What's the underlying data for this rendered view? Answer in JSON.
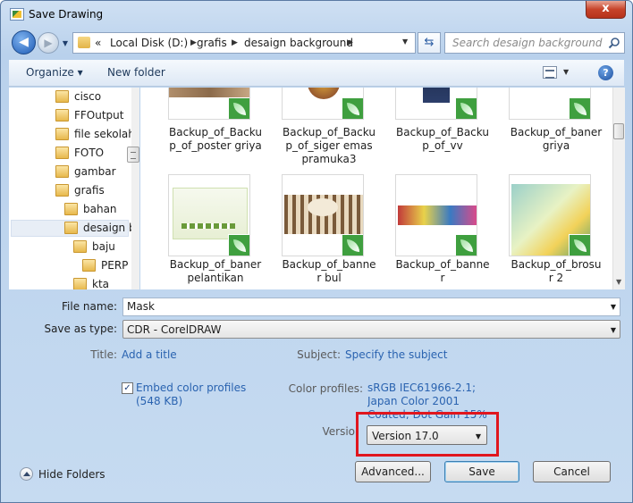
{
  "window": {
    "title": "Save Drawing",
    "close": "x"
  },
  "nav": {
    "back": "◀",
    "forward": "▶",
    "breadcrumb": [
      "«",
      "Local Disk (D:)",
      "grafis",
      "desaign background"
    ],
    "search_placeholder": "Search desaign background"
  },
  "toolbar": {
    "organize": "Organize ▾",
    "new_folder": "New folder",
    "help": "?"
  },
  "tree": {
    "items": [
      {
        "label": "cisco"
      },
      {
        "label": "FFOutput"
      },
      {
        "label": "file sekolah"
      },
      {
        "label": "FOTO"
      },
      {
        "label": "gambar"
      },
      {
        "label": "grafis"
      },
      {
        "label": "bahan"
      },
      {
        "label": "desaign b"
      },
      {
        "label": "baju"
      },
      {
        "label": "PERP"
      },
      {
        "label": "kta"
      }
    ]
  },
  "files": [
    {
      "name": "Backup_of_Backup_of_poster griya",
      "line1": "Backup_of_Backu",
      "line2": "p_of_poster griya",
      "line3": "",
      "thumb": "poster"
    },
    {
      "name": "Backup_of_Backup_of_siger emas pramuka3",
      "line1": "Backup_of_Backu",
      "line2": "p_of_siger emas",
      "line3": "pramuka3",
      "thumb": "siger"
    },
    {
      "name": "Backup_of_Backup_of_vv",
      "line1": "Backup_of_Backu",
      "line2": "p_of_vv",
      "line3": "",
      "thumb": "vv"
    },
    {
      "name": "Backup_of_baner griya",
      "line1": "Backup_of_baner",
      "line2": "griya",
      "line3": "",
      "thumb": "blank"
    },
    {
      "name": "Backup_of_baner pelantikan",
      "line1": "Backup_of_baner",
      "line2": "pelantikan",
      "line3": "",
      "thumb": "pelantikan"
    },
    {
      "name": "Backup_of_banner bul",
      "line1": "Backup_of_banne",
      "line2": "r bul",
      "line3": "",
      "thumb": "bul"
    },
    {
      "name": "Backup_of_banner",
      "line1": "Backup_of_banne",
      "line2": "r",
      "line3": "",
      "thumb": "banner"
    },
    {
      "name": "Backup_of_brosur 2",
      "line1": "Backup_of_brosu",
      "line2": "r 2",
      "line3": "",
      "thumb": "brosur"
    }
  ],
  "form": {
    "filename_label": "File name:",
    "filename_value": "Mask",
    "savetype_label": "Save as type:",
    "savetype_value": "CDR - CorelDRAW",
    "title_label": "Title:",
    "title_link": "Add a title",
    "subject_label": "Subject:",
    "subject_link": "Specify the subject",
    "embed_checked": true,
    "embed_label": "Embed color profiles (548 KB)",
    "color_profiles_label": "Color profiles:",
    "color_profiles_value": "sRGB IEC61966-2.1; Japan Color 2001 Coated; Dot Gain 15%",
    "version_label": "Versio",
    "version_value": "Version 17.0"
  },
  "buttons": {
    "advanced": "Advanced...",
    "save": "Save",
    "cancel": "Cancel"
  },
  "footer": {
    "hide_folders": "Hide Folders"
  },
  "colors": {
    "highlight": "#e0161e",
    "link": "#2a63b0",
    "cdr_badge": "#3f9f3f"
  }
}
